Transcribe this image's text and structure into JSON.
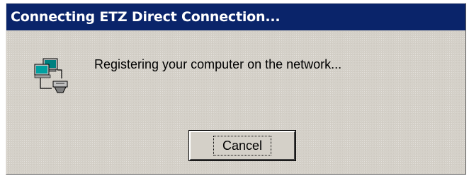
{
  "window": {
    "title": "Connecting ETZ Direct Connection..."
  },
  "dialog": {
    "message": "Registering your computer on the network...",
    "icon": "network-computers-icon"
  },
  "buttons": {
    "cancel_label": "Cancel"
  },
  "colors": {
    "titlebar": "#0a246a",
    "dialog_bg": "#d4d0c8"
  }
}
